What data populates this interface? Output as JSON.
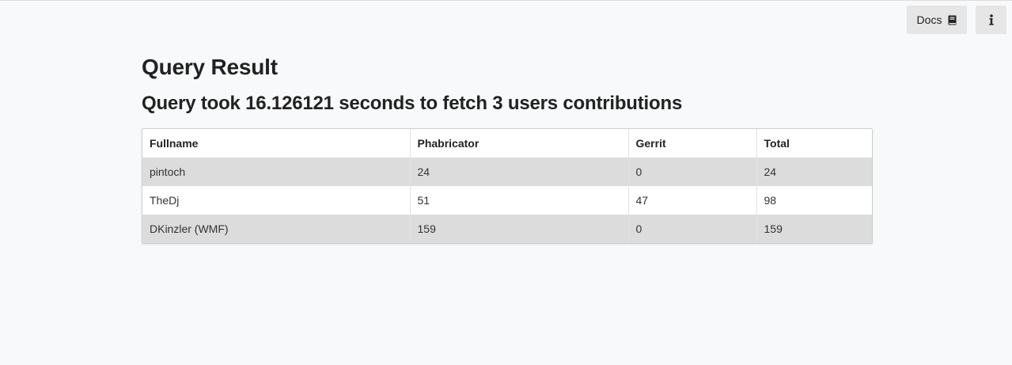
{
  "header": {
    "docs_label": "Docs",
    "docs_icon": "book-icon",
    "info_icon": "info-icon"
  },
  "main": {
    "title": "Query Result",
    "subtitle": "Query took 16.126121 seconds to fetch 3 users contributions"
  },
  "table": {
    "columns": [
      "Fullname",
      "Phabricator",
      "Gerrit",
      "Total"
    ],
    "rows": [
      [
        "pintoch",
        "24",
        "0",
        "24"
      ],
      [
        "TheDj",
        "51",
        "47",
        "98"
      ],
      [
        "DKinzler (WMF)",
        "159",
        "0",
        "159"
      ]
    ]
  },
  "colors": {
    "background": "#f8f9fa",
    "button_bg": "#e6e6e6",
    "stripe": "#dcdcdc"
  }
}
